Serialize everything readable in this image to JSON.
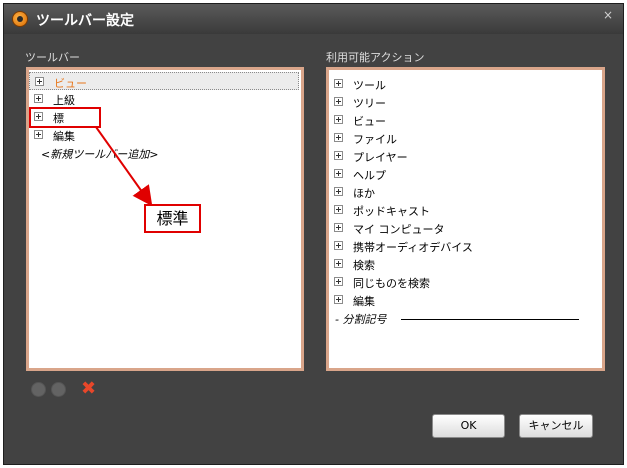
{
  "window": {
    "title": "ツールバー設定",
    "close_glyph": "×"
  },
  "left_panel": {
    "label": "ツールバー",
    "items": [
      {
        "label": "ビュー",
        "state": "selected"
      },
      {
        "label": "上級"
      },
      {
        "label": "標"
      },
      {
        "label": "編集"
      }
    ],
    "add_new": "<新規ツールバー追加>"
  },
  "right_panel": {
    "label": "利用可能アクション",
    "items": [
      {
        "label": "ツール"
      },
      {
        "label": "ツリー"
      },
      {
        "label": "ビュー"
      },
      {
        "label": "ファイル"
      },
      {
        "label": "プレイヤー"
      },
      {
        "label": "ヘルプ"
      },
      {
        "label": "ほか"
      },
      {
        "label": "ポッドキャスト"
      },
      {
        "label": "マイ コンピュータ"
      },
      {
        "label": "携帯オーディオデバイス"
      },
      {
        "label": "検索"
      },
      {
        "label": "同じものを検索"
      },
      {
        "label": "編集"
      }
    ],
    "separator": "- 分割記号"
  },
  "toolbar_buttons": {
    "move_up_icon": "circle-icon",
    "move_down_icon": "circle-icon",
    "delete_glyph": "✖"
  },
  "buttons": {
    "ok": "OK",
    "cancel": "キャンセル"
  },
  "annotation": {
    "callout_text": "標準",
    "color": "#e00000"
  },
  "colors": {
    "window_bg": "#424242",
    "panel_border": "#d9a58a",
    "selected_text": "#e8761a"
  }
}
